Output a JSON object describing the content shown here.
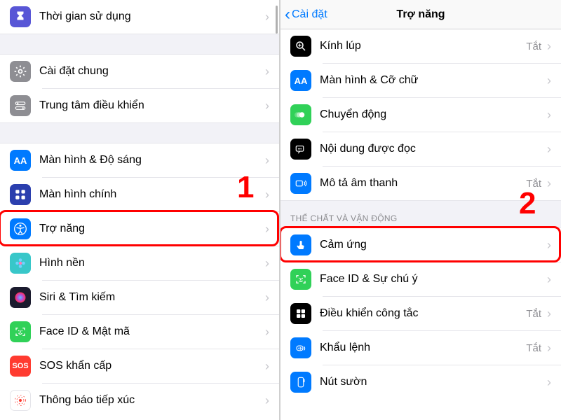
{
  "left": {
    "rows": [
      {
        "label": "Thời gian sử dụng",
        "icon": "hourglass",
        "bg": "#5856d6"
      },
      {
        "gap": true
      },
      {
        "label": "Cài đặt chung",
        "icon": "gear",
        "bg": "#8e8e93"
      },
      {
        "label": "Trung tâm điều khiển",
        "icon": "switches",
        "bg": "#8e8e93"
      },
      {
        "gap": true
      },
      {
        "label": "Màn hình & Độ sáng",
        "icon": "AA",
        "bg": "#007aff",
        "text": "AA"
      },
      {
        "label": "Màn hình chính",
        "icon": "grid-blue",
        "bg": "#2b3fae"
      },
      {
        "label": "Trợ năng",
        "icon": "accessibility",
        "bg": "#007aff",
        "highlight": true
      },
      {
        "label": "Hình nền",
        "icon": "flower",
        "bg": "#38c7c9"
      },
      {
        "label": "Siri & Tìm kiếm",
        "icon": "siri",
        "bg": "#1b1b2e"
      },
      {
        "label": "Face ID & Mật mã",
        "icon": "faceid",
        "bg": "#30d158"
      },
      {
        "label": "SOS khẩn cấp",
        "icon": "sos",
        "bg": "#ff3b30",
        "text": "SOS"
      },
      {
        "label": "Thông báo tiếp xúc",
        "icon": "exposure",
        "bg": "#ffffff",
        "fg": "#ff3b30"
      }
    ],
    "annotation": "1"
  },
  "right": {
    "back": "Cài đặt",
    "title": "Trợ năng",
    "rows": [
      {
        "label": "Kính lúp",
        "icon": "magnify",
        "bg": "#000",
        "value": "Tắt"
      },
      {
        "label": "Màn hình & Cỡ chữ",
        "icon": "AA",
        "bg": "#007aff",
        "text": "AA"
      },
      {
        "label": "Chuyển động",
        "icon": "motion",
        "bg": "#30d158"
      },
      {
        "label": "Nội dung được đọc",
        "icon": "speak",
        "bg": "#000"
      },
      {
        "label": "Mô tả âm thanh",
        "icon": "audiodesc",
        "bg": "#007aff",
        "value": "Tắt"
      },
      {
        "header": "THỂ CHẤT VÀ VẬN ĐỘNG"
      },
      {
        "label": "Cảm ứng",
        "icon": "touch",
        "bg": "#007aff",
        "highlight": true
      },
      {
        "label": "Face ID & Sự chú ý",
        "icon": "faceid",
        "bg": "#30d158"
      },
      {
        "label": "Điều khiển công tắc",
        "icon": "switchctrl",
        "bg": "#000",
        "value": "Tắt"
      },
      {
        "label": "Khẩu lệnh",
        "icon": "voice",
        "bg": "#007aff",
        "value": "Tắt"
      },
      {
        "label": "Nút sườn",
        "icon": "sidebutton",
        "bg": "#007aff"
      }
    ],
    "annotation": "2"
  },
  "off_label": "Tắt"
}
